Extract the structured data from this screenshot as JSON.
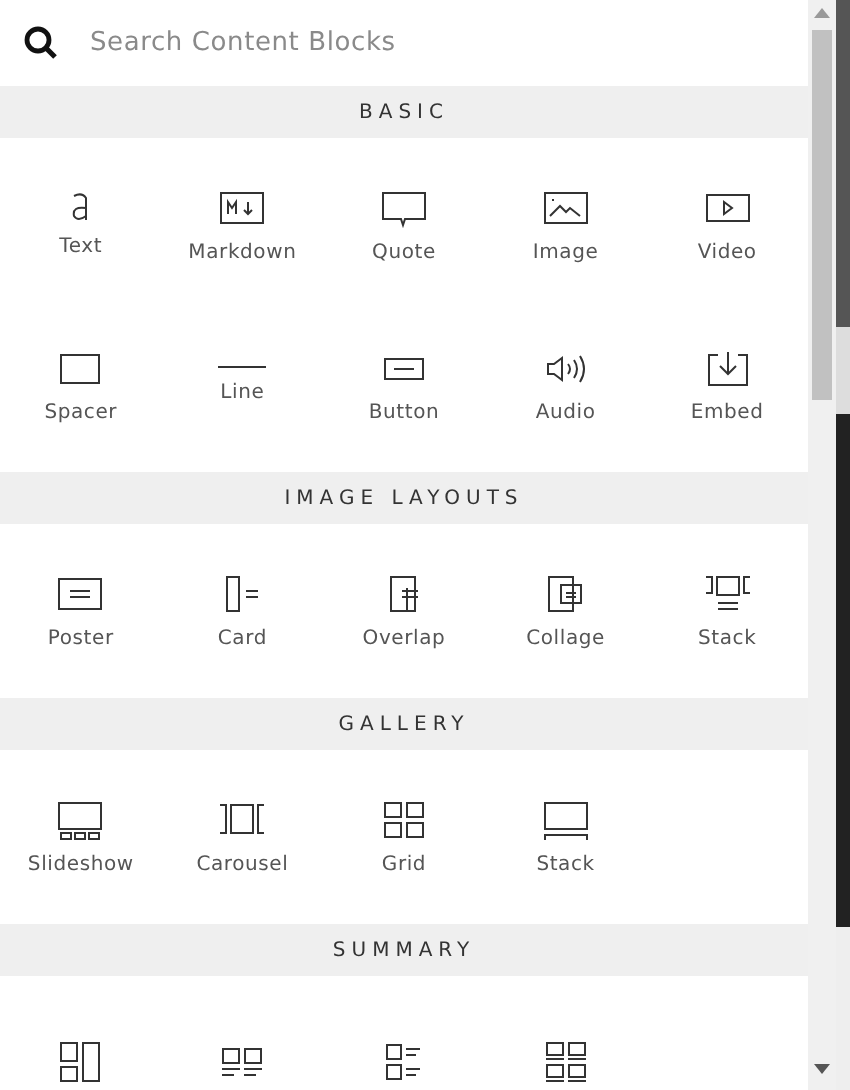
{
  "search": {
    "placeholder": "Search Content Blocks"
  },
  "sections": [
    {
      "title": "BASIC",
      "blocks": [
        {
          "kind": "text",
          "label": "Text"
        },
        {
          "kind": "markdown",
          "label": "Markdown"
        },
        {
          "kind": "quote",
          "label": "Quote"
        },
        {
          "kind": "image",
          "label": "Image"
        },
        {
          "kind": "video",
          "label": "Video"
        },
        {
          "kind": "spacer",
          "label": "Spacer"
        },
        {
          "kind": "line",
          "label": "Line"
        },
        {
          "kind": "button",
          "label": "Button"
        },
        {
          "kind": "audio",
          "label": "Audio"
        },
        {
          "kind": "embed",
          "label": "Embed"
        }
      ]
    },
    {
      "title": "IMAGE LAYOUTS",
      "blocks": [
        {
          "kind": "poster",
          "label": "Poster"
        },
        {
          "kind": "card",
          "label": "Card"
        },
        {
          "kind": "overlap",
          "label": "Overlap"
        },
        {
          "kind": "collage",
          "label": "Collage"
        },
        {
          "kind": "stack",
          "label": "Stack"
        }
      ]
    },
    {
      "title": "GALLERY",
      "blocks": [
        {
          "kind": "slideshow",
          "label": "Slideshow"
        },
        {
          "kind": "carousel",
          "label": "Carousel"
        },
        {
          "kind": "grid",
          "label": "Grid"
        },
        {
          "kind": "strip",
          "label": "Stack"
        }
      ]
    },
    {
      "title": "SUMMARY",
      "blocks": [
        {
          "kind": "wall"
        },
        {
          "kind": "cards"
        },
        {
          "kind": "list"
        },
        {
          "kind": "tiles"
        }
      ]
    }
  ]
}
